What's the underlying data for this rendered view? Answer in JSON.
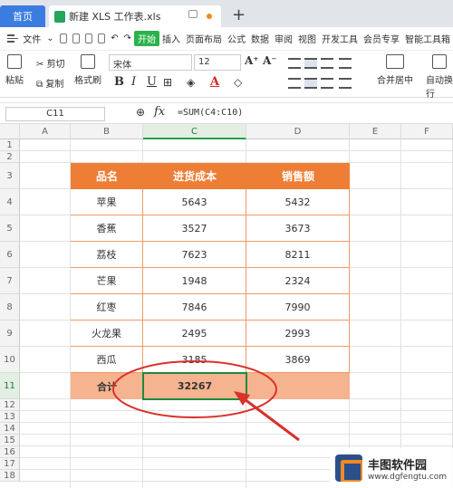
{
  "tabs": {
    "home": "首页",
    "file": "新建 XLS 工作表.xls",
    "new_tab": "+"
  },
  "menu": {
    "file": "文件",
    "items": [
      "开始",
      "插入",
      "页面布局",
      "公式",
      "数据",
      "审阅",
      "视图",
      "开发工具",
      "会员专享",
      "智能工具箱"
    ],
    "active_index": 0
  },
  "ribbon": {
    "paste": "粘贴",
    "cut": "剪切",
    "copy": "复制",
    "format_painter": "格式刷",
    "font_name": "宋体",
    "font_size": "12",
    "bold": "B",
    "italic": "I",
    "underline": "U",
    "font_color_letter": "A",
    "merge": "合并居中",
    "wrap": "自动换行"
  },
  "formula_bar": {
    "cell_ref": "C11",
    "fx": "fx",
    "formula": "=SUM(C4:C10)"
  },
  "sheet": {
    "columns": [
      "A",
      "B",
      "C",
      "D",
      "E",
      "F"
    ],
    "selected_column": "C",
    "rows": [
      "1",
      "2",
      "3",
      "4",
      "5",
      "6",
      "7",
      "8",
      "9",
      "10",
      "11",
      "12",
      "13",
      "14",
      "15",
      "16",
      "17",
      "18"
    ],
    "selected_row": "11",
    "table": {
      "headers": [
        "品名",
        "进货成本",
        "销售额"
      ],
      "data": [
        [
          "苹果",
          "5643",
          "5432"
        ],
        [
          "香蕉",
          "3527",
          "3673"
        ],
        [
          "荔枝",
          "7623",
          "8211"
        ],
        [
          "芒果",
          "1948",
          "2324"
        ],
        [
          "红枣",
          "7846",
          "7990"
        ],
        [
          "火龙果",
          "2495",
          "2993"
        ],
        [
          "西瓜",
          "3185",
          "3869"
        ]
      ],
      "total_label": "合计",
      "total_value": "32267",
      "total_sales": ""
    },
    "colors": {
      "header_bg": "#ee7e36",
      "total_bg": "#f5b38f",
      "annotation": "#d9322b",
      "selection": "#1f8a3c"
    }
  },
  "watermark": {
    "title": "丰图软件园",
    "url": "www.dgfengtu.com"
  }
}
